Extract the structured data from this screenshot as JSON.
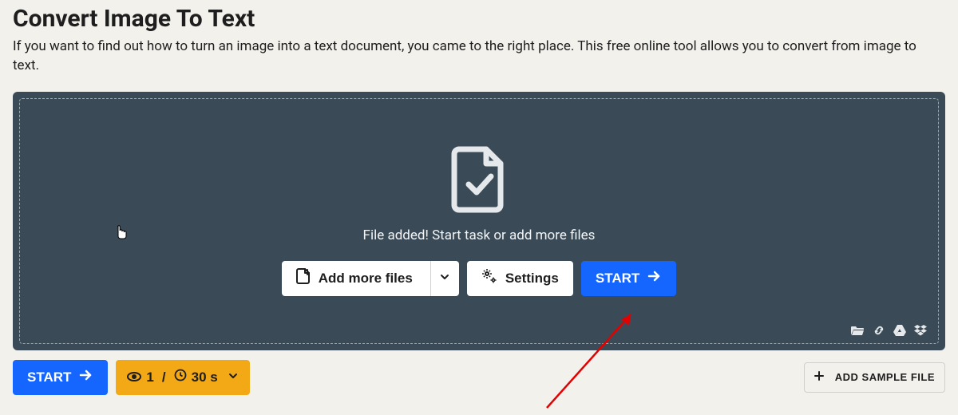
{
  "title": "Convert Image To Text",
  "description": "If you want to find out how to turn an image into a text document, you came to the right place. This free online tool allows you to convert from image to text.",
  "dropzone": {
    "status_text": "File added! Start task or add more files",
    "add_more_label": "Add more files",
    "settings_label": "Settings",
    "start_label": "START"
  },
  "bottom": {
    "start_label": "START",
    "queue_count": "1",
    "queue_sep": "/",
    "queue_time": "30 s",
    "sample_label": "ADD SAMPLE FILE"
  },
  "colors": {
    "accent_blue": "#1566ff",
    "dropzone_bg": "#3a4b57",
    "orange": "#f3a816",
    "page_bg": "#f3f1ec"
  }
}
